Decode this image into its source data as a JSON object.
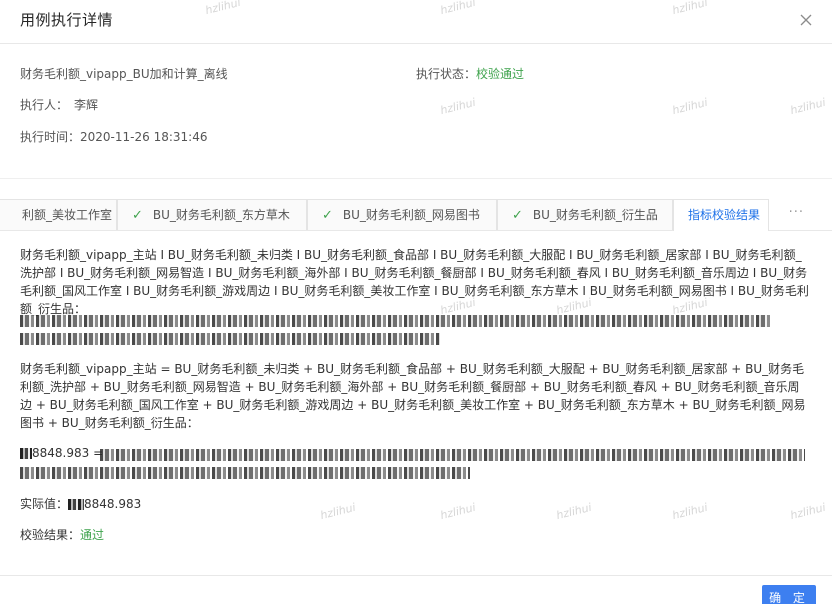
{
  "modal": {
    "title": "用例执行详情",
    "close_icon": "close-icon"
  },
  "info": {
    "case_name": "财务毛利额_vipapp_BU加和计算_离线",
    "status_label": "执行状态：",
    "status_value": "校验通过",
    "executor_label": "执行人：",
    "executor_value": "李辉",
    "time_label": "执行时间：",
    "time_value": "2020-11-26 18:31:46"
  },
  "tabs": [
    {
      "label": "利额_美妆工作室",
      "checked": false
    },
    {
      "label": "BU_财务毛利额_东方草木",
      "checked": true
    },
    {
      "label": "BU_财务毛利额_网易图书",
      "checked": true
    },
    {
      "label": "BU_财务毛利额_衍生品",
      "checked": true
    },
    {
      "label": "指标校验结果",
      "checked": false,
      "active": true
    }
  ],
  "tab_more": "···",
  "result": {
    "para1": "财务毛利额_vipapp_主站 I BU_财务毛利额_未归类 I BU_财务毛利额_食品部 I BU_财务毛利额_大服配 I BU_财务毛利额_居家部 I BU_财务毛利额_洗护部 I BU_财务毛利额_网易智造 I BU_财务毛利额_海外部 I BU_财务毛利额_餐厨部 I BU_财务毛利额_春风 I BU_财务毛利额_音乐周边 I BU_财务毛利额_国风工作室 I BU_财务毛利额_游戏周边 I BU_财务毛利额_美妆工作室 I BU_财务毛利额_东方草木 I BU_财务毛利额_网易图书 I BU_财务毛利额_衍生品：",
    "para2": "财务毛利额_vipapp_主站 = BU_财务毛利额_未归类 + BU_财务毛利额_食品部 + BU_财务毛利额_大服配 + BU_财务毛利额_居家部 + BU_财务毛利额_洗护部 + BU_财务毛利额_网易智造 + BU_财务毛利额_海外部 + BU_财务毛利额_餐厨部 + BU_财务毛利额_春风 + BU_财务毛利额_音乐周边 + BU_财务毛利额_国风工作室 + BU_财务毛利额_游戏周边 + BU_财务毛利额_美妆工作室 + BU_财务毛利额_东方草木 + BU_财务毛利额_网易图书 + BU_财务毛利额_衍生品：",
    "sum_value": "8848.983 =",
    "actual_label": "实际值：",
    "actual_value": "8848.983",
    "verify_label": "校验结果：",
    "verify_value": "通过"
  },
  "footer": {
    "confirm_label": "确 定"
  },
  "watermark": "hzlihui",
  "colors": {
    "success": "#3fa34d",
    "primary": "#3d7ff0",
    "active_tab": "#1f72e8"
  }
}
